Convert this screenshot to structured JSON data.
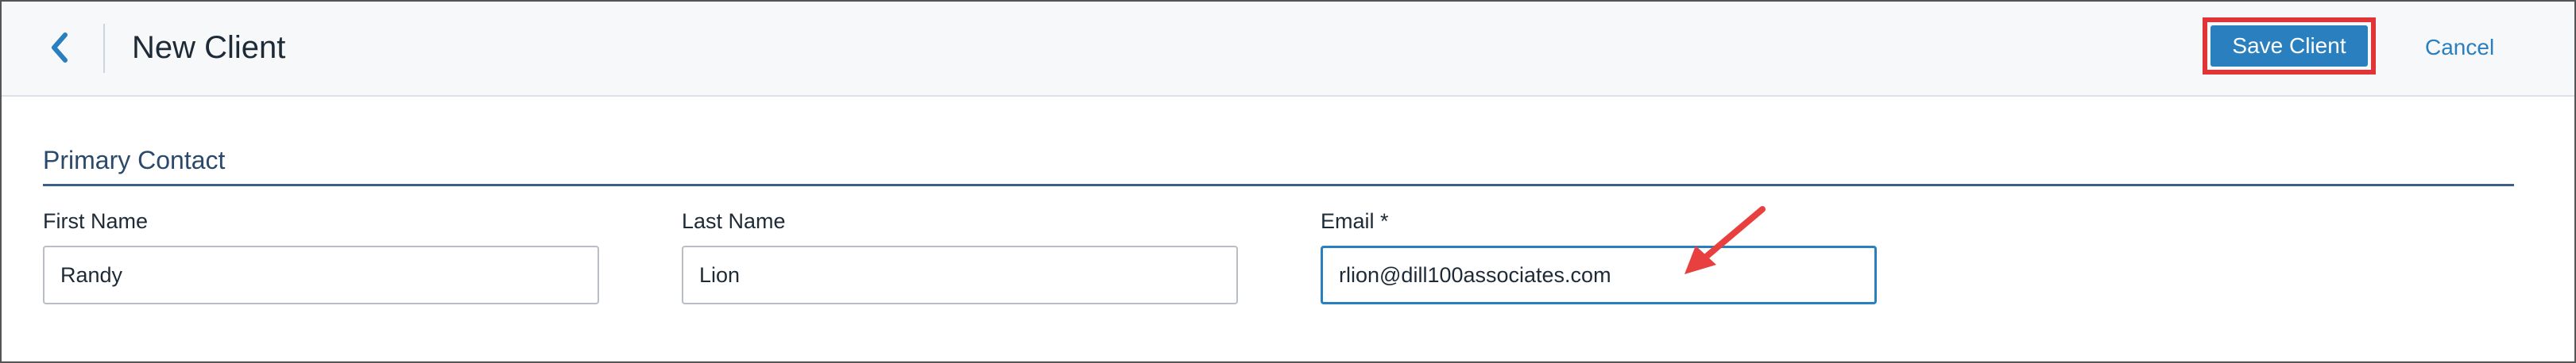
{
  "header": {
    "title": "New Client",
    "save_label": "Save Client",
    "cancel_label": "Cancel",
    "back_icon": "chevron-left-icon"
  },
  "section": {
    "title": "Primary Contact"
  },
  "fields": {
    "first_name": {
      "label": "First Name",
      "value": "Randy"
    },
    "last_name": {
      "label": "Last Name",
      "value": "Lion"
    },
    "email": {
      "label": "Email *",
      "value": "rlion@dill100associates.com"
    }
  },
  "colors": {
    "accent": "#2a7fbf",
    "highlight": "#e03437",
    "annotation": "#e8403f",
    "section_title": "#2b4a6b"
  }
}
